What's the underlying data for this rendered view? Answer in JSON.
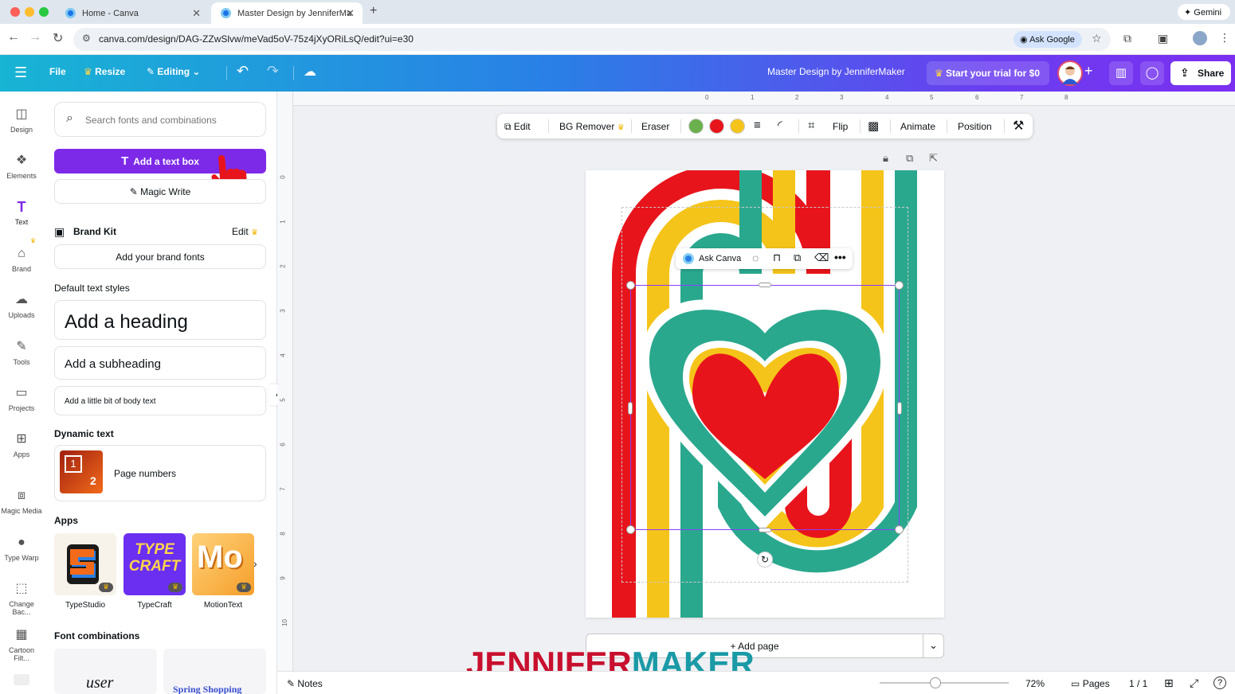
{
  "browser": {
    "tabs": [
      {
        "label": "Home - Canva",
        "active": false
      },
      {
        "label": "Master Design by JenniferMa",
        "active": true
      }
    ],
    "url": "canva.com/design/DAG-ZZwSlvw/meVad5oV-75z4jXyORiLsQ/edit?ui=e30",
    "ask_google": "Ask Google",
    "gemini": "Gemini"
  },
  "header": {
    "file": "File",
    "resize": "Resize",
    "editing": "Editing",
    "title": "Master Design by JenniferMaker",
    "trial": "Start your trial for $0",
    "share": "Share"
  },
  "rail": [
    {
      "label": "Design",
      "icon": "design-icon"
    },
    {
      "label": "Elements",
      "icon": "elements-icon"
    },
    {
      "label": "Text",
      "icon": "text-icon"
    },
    {
      "label": "Brand",
      "icon": "brand-icon"
    },
    {
      "label": "Uploads",
      "icon": "uploads-icon"
    },
    {
      "label": "Tools",
      "icon": "tools-icon"
    },
    {
      "label": "Projects",
      "icon": "projects-icon"
    },
    {
      "label": "Apps",
      "icon": "apps-icon"
    },
    {
      "label": "Magic Media",
      "icon": "magic-media-icon"
    },
    {
      "label": "Type Warp",
      "icon": "type-warp-icon"
    },
    {
      "label": "Change Bac...",
      "icon": "change-background-icon"
    },
    {
      "label": "Cartoon Filt...",
      "icon": "cartoon-filter-icon"
    }
  ],
  "panel": {
    "search_placeholder": "Search fonts and combinations",
    "add_text_box": "Add a text box",
    "magic_write": "Magic Write",
    "brand_kit": "Brand Kit",
    "brand_edit": "Edit",
    "add_brand_fonts": "Add your brand fonts",
    "default_styles": "Default text styles",
    "heading": "Add a heading",
    "subheading": "Add a subheading",
    "body": "Add a little bit of body text",
    "dynamic_text": "Dynamic text",
    "page_numbers": "Page numbers",
    "page_num_thumb_1": "1",
    "page_num_thumb_2": "2",
    "apps_label": "Apps",
    "apps": [
      {
        "name": "TypeStudio"
      },
      {
        "name": "TypeCraft",
        "thumb": "TYPE CRAFT"
      },
      {
        "name": "MotionText",
        "thumb": "Mo"
      }
    ],
    "font_combinations": "Font combinations",
    "combo_1": "user",
    "combo_2": "Spring Shopping"
  },
  "toolbar": {
    "edit": "Edit",
    "bg_remover": "BG Remover",
    "eraser": "Eraser",
    "colors": [
      "#6ab04c",
      "#e8141c",
      "#f5c41a"
    ],
    "flip": "Flip",
    "animate": "Animate",
    "position": "Position"
  },
  "ask_canva": "Ask Canva",
  "ruler_top": [
    "0",
    "1",
    "2",
    "3",
    "4",
    "5",
    "6",
    "7",
    "8"
  ],
  "ruler_left": [
    "0",
    "1",
    "2",
    "3",
    "4",
    "5",
    "6",
    "7",
    "8",
    "9",
    "10"
  ],
  "add_page": "+ Add page",
  "footer": {
    "notes": "Notes",
    "zoom": "72%",
    "zoom_level": 0.43,
    "pages": "Pages",
    "page_count": "1 / 1"
  },
  "watermark": {
    "part1": "JENNIFER",
    "part2": "MAKER"
  },
  "design_colors": {
    "red": "#e8141c",
    "yellow": "#f5c41a",
    "teal": "#2aa88e"
  }
}
